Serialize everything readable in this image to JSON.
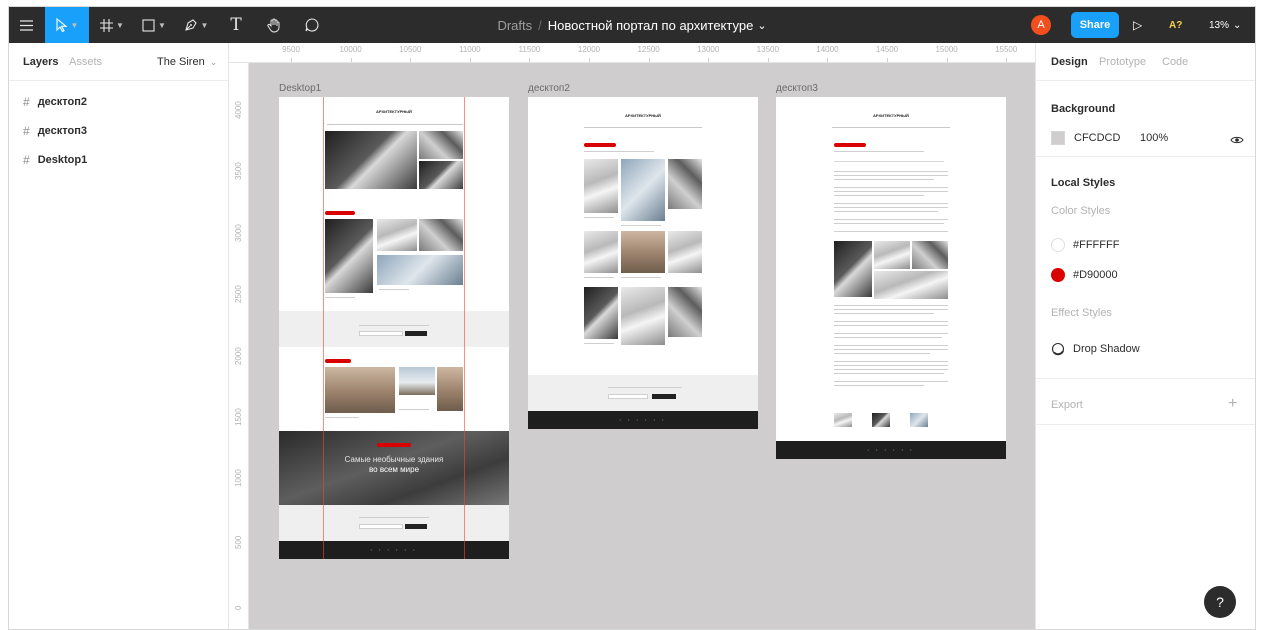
{
  "toolbar": {
    "menu_icon": "hamburger-menu-icon",
    "tools": [
      {
        "name": "move-tool",
        "icon": "cursor-icon",
        "active": true
      },
      {
        "name": "frame-tool",
        "icon": "hash-icon"
      },
      {
        "name": "shape-tool",
        "icon": "rectangle-icon"
      },
      {
        "name": "pen-tool",
        "icon": "pen-icon"
      },
      {
        "name": "text-tool",
        "icon": "text-icon",
        "glyph": "T"
      },
      {
        "name": "hand-tool",
        "icon": "hand-icon"
      },
      {
        "name": "comment-tool",
        "icon": "comment-icon"
      }
    ],
    "breadcrumb": "Drafts",
    "separator": "/",
    "file_title": "Новостной портал по архитектуре",
    "file_caret": "⌄",
    "avatar_letter": "A",
    "share_label": "Share",
    "present_icon": "play-icon",
    "present_glyph": "▷",
    "ai_label": "A?",
    "zoom_label": "13%",
    "zoom_caret": "⌄"
  },
  "left_panel": {
    "tabs": {
      "layers": "Layers",
      "assets": "Assets",
      "page": "The Siren",
      "page_caret": "⌄"
    },
    "layers": [
      {
        "name": "десктоп2"
      },
      {
        "name": "десктоп3"
      },
      {
        "name": "Desktop1"
      }
    ],
    "layer_glyph": "#"
  },
  "ruler": {
    "top": [
      "9500",
      "10000",
      "10500",
      "11000",
      "11500",
      "12000",
      "12500",
      "13000",
      "13500",
      "14000",
      "14500",
      "15000",
      "15500"
    ],
    "left": [
      "4000",
      "3500",
      "3000",
      "2500",
      "2000",
      "1500",
      "1000",
      "500",
      "0"
    ]
  },
  "canvas": {
    "background": "#CFCDCD",
    "frames": [
      {
        "label": "Desktop1",
        "logo": "АРХИТЕКТУРНЫЙ",
        "hero_line1": "Самые необычные здания",
        "hero_line2": "во всем мире",
        "dots": "• • • • • •"
      },
      {
        "label": "десктоп2",
        "logo": "АРХИТЕКТУРНЫЙ",
        "dots": "• • • • • •"
      },
      {
        "label": "десктоп3",
        "logo": "АРХИТЕКТУРНЫЙ",
        "dots": "• • • • • •"
      }
    ]
  },
  "right_panel": {
    "tabs": {
      "design": "Design",
      "prototype": "Prototype",
      "code": "Code"
    },
    "background": {
      "title": "Background",
      "hex": "CFCDCD",
      "opacity": "100%",
      "color": "#CFCDCD",
      "eye_icon": "eye-icon"
    },
    "local_styles": {
      "title": "Local Styles",
      "color_styles_label": "Color Styles",
      "colors": [
        {
          "name": "#FFFFFF",
          "color": "#FFFFFF"
        },
        {
          "name": "#D90000",
          "color": "#D90000"
        }
      ],
      "effect_styles_label": "Effect Styles",
      "effects": [
        {
          "name": "Drop Shadow",
          "icon": "drop-shadow-icon"
        }
      ]
    },
    "export": {
      "title": "Export",
      "add_glyph": "+"
    }
  },
  "help_glyph": "?"
}
